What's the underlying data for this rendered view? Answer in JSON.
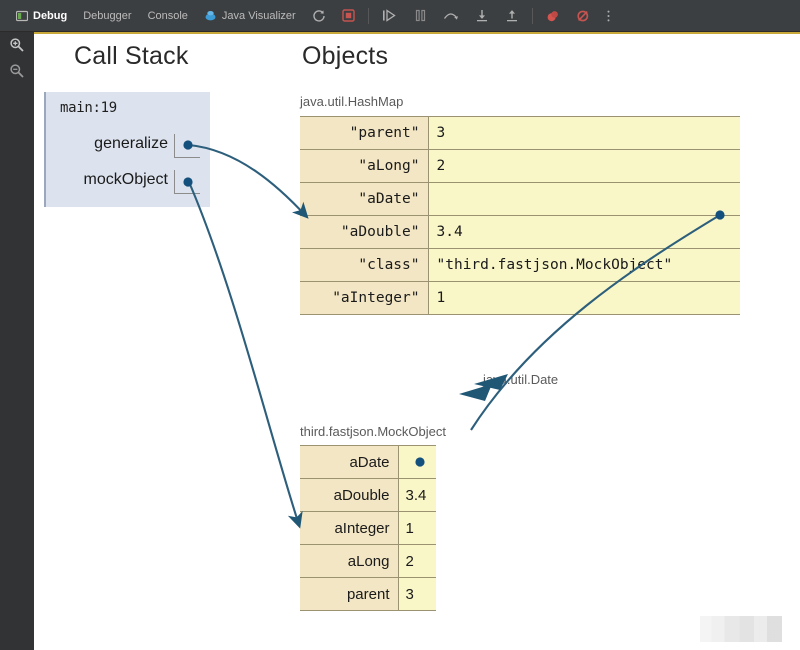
{
  "toolbar": {
    "tabs": [
      {
        "label": "Debug",
        "icon": "debug-window-icon",
        "active": true
      },
      {
        "label": "Debugger",
        "icon": "",
        "active": false
      },
      {
        "label": "Console",
        "icon": "",
        "active": false
      },
      {
        "label": "Java Visualizer",
        "icon": "java-visualizer-icon",
        "active": false
      }
    ],
    "buttons": [
      {
        "name": "rerun-icon",
        "glyph": "rerun"
      },
      {
        "name": "stop-icon",
        "glyph": "stop"
      },
      {
        "name": "resume-program-icon",
        "glyph": "resume"
      },
      {
        "name": "pause-program-icon",
        "glyph": "pause"
      },
      {
        "name": "step-over-icon",
        "glyph": "step-over"
      },
      {
        "name": "step-into-icon",
        "glyph": "step-into"
      },
      {
        "name": "step-out-icon",
        "glyph": "step-out"
      },
      {
        "name": "mute-breakpoints-icon",
        "glyph": "breakpoint"
      },
      {
        "name": "view-breakpoints-icon",
        "glyph": "breakpoint-muted"
      },
      {
        "name": "more-options-icon",
        "glyph": "kebab"
      }
    ]
  },
  "left_rail": [
    {
      "name": "zoom-in-icon",
      "label": "zoom in"
    },
    {
      "name": "zoom-out-icon",
      "label": "zoom out"
    }
  ],
  "canvas": {
    "headings": {
      "call_stack": "Call Stack",
      "objects": "Objects"
    },
    "call_stack": {
      "frame_title": "main:19",
      "variables": [
        {
          "name": "generalize",
          "label": "generalize"
        },
        {
          "name": "mockObject",
          "label": "mockObject"
        }
      ]
    },
    "objects": [
      {
        "id": "hashmap",
        "type_label": "java.util.HashMap",
        "rows": [
          {
            "key": "\"parent\"",
            "value": "3"
          },
          {
            "key": "\"aLong\"",
            "value": "2"
          },
          {
            "key": "\"aDate\"",
            "value": ""
          },
          {
            "key": "\"aDouble\"",
            "value": "3.4"
          },
          {
            "key": "\"class\"",
            "value": "\"third.fastjson.MockObject\""
          },
          {
            "key": "\"aInteger\"",
            "value": "1"
          }
        ]
      },
      {
        "id": "mockobject",
        "type_label": "third.fastjson.MockObject",
        "rows": [
          {
            "key": "aDate",
            "value": ""
          },
          {
            "key": "aDouble",
            "value": "3.4"
          },
          {
            "key": "aInteger",
            "value": "1"
          },
          {
            "key": "aLong",
            "value": "2"
          },
          {
            "key": "parent",
            "value": "3"
          }
        ]
      }
    ],
    "floating_labels": [
      {
        "id": "date",
        "text": "java.util.Date"
      }
    ]
  },
  "colors": {
    "toolbar_bg": "#3c3f41",
    "rail_bg": "#313335",
    "canvas_bg": "#ffffff",
    "accent_line": "#c8a838",
    "frame_bg": "#dde3ee",
    "table_key_bg": "#f3e6c4",
    "table_value_bg": "#f9f7c8",
    "table_border": "#9a9270",
    "arrow": "#2d5f7c",
    "pointer_dot": "#14507d"
  }
}
